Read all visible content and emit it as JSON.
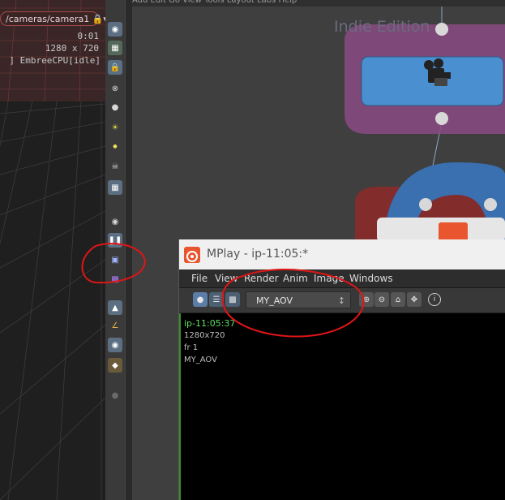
{
  "viewport": {
    "camera_path": "/cameras/camera1",
    "time_readout": "0:01",
    "resolution_readout": "1280 x 720",
    "renderer_status": "] EmbreeCPU[idle]"
  },
  "network": {
    "watermark": "Indie Edition",
    "menu_partial": "Add   Edit   Go   View   Tools   Layout   Labs   Help"
  },
  "mplay": {
    "title": "MPlay - ip-11:05:*",
    "menu": [
      "File",
      "View",
      "Render",
      "Anim",
      "Image",
      "Windows"
    ],
    "aov_selected": "MY_AOV",
    "info_name": "ip-11:05:37",
    "info_resolution": "1280x720",
    "info_frame": "fr 1",
    "info_aov": "MY_AOV"
  },
  "colors": {
    "accent_blue": "#4a8fd0",
    "node_pink": "#b04a9a",
    "info_green": "#5fe05f",
    "annotation_red": "#e01515"
  }
}
